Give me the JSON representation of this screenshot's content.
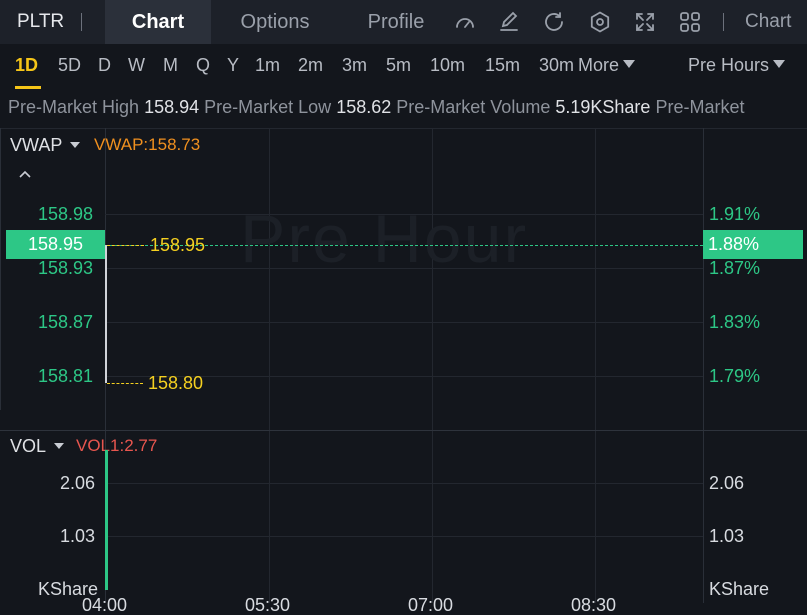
{
  "header": {
    "ticker": "PLTR",
    "tabs": [
      {
        "label": "Chart",
        "active": true
      },
      {
        "label": "Options",
        "active": false
      },
      {
        "label": "Profile",
        "active": false
      }
    ],
    "icons": [
      "gauge-icon",
      "edit-icon",
      "refresh-icon",
      "settings-icon",
      "fullscreen-icon",
      "grid-icon"
    ],
    "chart_link": "Chart"
  },
  "periods": {
    "items": [
      "1D",
      "5D",
      "D",
      "W",
      "M",
      "Q",
      "Y",
      "1m",
      "2m",
      "3m",
      "5m",
      "10m",
      "15m",
      "30m"
    ],
    "active": "1D",
    "more_label": "More",
    "session_label": "Pre Hours"
  },
  "info": {
    "high_label": "Pre-Market High",
    "high_value": "158.94",
    "low_label": "Pre-Market Low",
    "low_value": "158.62",
    "volume_label": "Pre-Market Volume",
    "volume_value": "5.19KShare",
    "trailing_label": "Pre-Market"
  },
  "price_panel": {
    "indicator_label": "VWAP",
    "indicator_value": "VWAP:158.73",
    "watermark": "Pre Hour",
    "left_axis": [
      "158.98",
      "158.93",
      "158.87",
      "158.81"
    ],
    "right_axis": [
      "1.91%",
      "1.87%",
      "1.83%",
      "1.79%"
    ],
    "current_price": "158.95",
    "current_pct": "1.88%",
    "high_marker": "158.95",
    "low_marker": "158.80"
  },
  "volume_panel": {
    "indicator_label": "VOL",
    "indicator_value": "VOL1:2.77",
    "left_axis": [
      "2.06",
      "1.03",
      "KShare"
    ],
    "right_axis": [
      "2.06",
      "1.03",
      "KShare"
    ]
  },
  "time_axis": [
    "04:00",
    "05:30",
    "07:00",
    "08:30"
  ],
  "colors": {
    "up": "#2dc786",
    "marker": "#f5d020",
    "vwap": "#f0901f",
    "vol_indicator": "#e8564f",
    "active_period": "#f5c518"
  }
}
